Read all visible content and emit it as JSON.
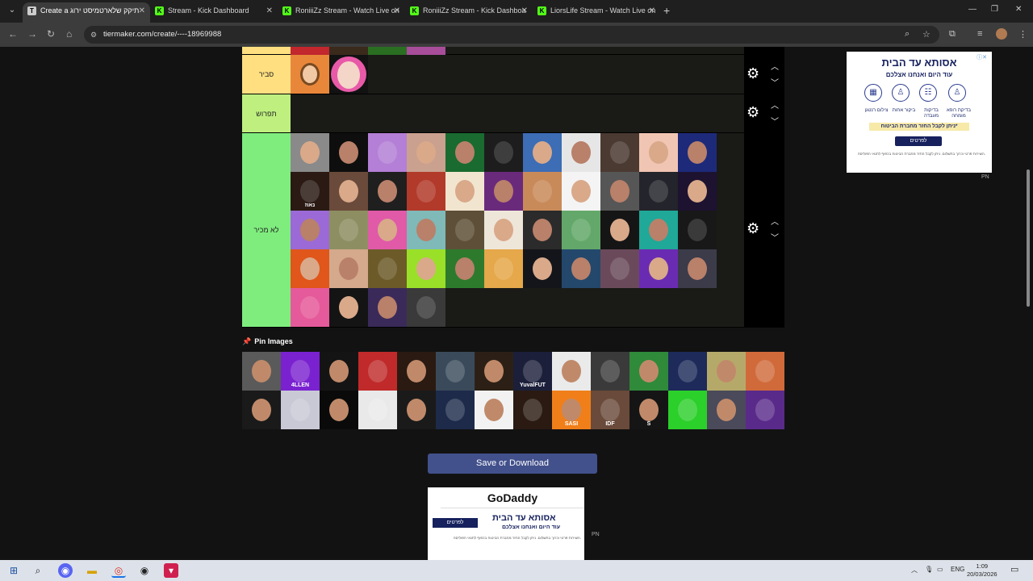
{
  "browser": {
    "tabs": [
      {
        "title": "Create a תיקק שלארטמיסט ירוג",
        "favicon": "tiermaker-icon",
        "active": true
      },
      {
        "title": "Stream - Kick Dashboard",
        "favicon": "kick-icon",
        "active": false
      },
      {
        "title": "RoniiiZz Stream - Watch Live on",
        "favicon": "kick-icon",
        "active": false
      },
      {
        "title": "RoniiiZz Stream - Kick Dashboa",
        "favicon": "kick-icon",
        "active": false
      },
      {
        "title": "LiorsLife Stream - Watch Live on",
        "favicon": "kick-icon",
        "active": false
      }
    ],
    "url": "tiermaker.com/create/----18969988"
  },
  "tiers": [
    {
      "label": "סביר",
      "color": "#ffdf80"
    },
    {
      "label": "תפרוש",
      "color": "#bff07f"
    },
    {
      "label": "לא מכיר",
      "color": "#7fed7e"
    }
  ],
  "pin": {
    "title": "Pin Images"
  },
  "pin_thumbs": [
    "",
    "4LLEN",
    "",
    "",
    "",
    "",
    "",
    "YuvalFUT",
    "",
    "",
    "",
    "",
    "",
    "",
    "",
    "",
    "",
    "",
    "",
    "",
    "",
    "",
    "SASI",
    "IDF",
    "S",
    "",
    ""
  ],
  "tier_thumbs_row3": [
    "",
    "",
    "",
    "",
    "",
    "",
    "",
    "",
    "",
    "",
    "",
    "נאוז",
    "",
    "",
    "",
    "",
    "",
    "",
    "",
    "",
    "",
    "",
    "",
    "",
    "",
    "",
    "",
    "",
    "",
    "",
    "",
    "",
    "",
    "",
    "",
    "",
    "",
    "",
    "",
    "",
    "",
    "",
    "",
    "",
    "",
    "",
    "",
    "",
    "",
    "",
    "",
    ""
  ],
  "save_button": "Save or Download",
  "ads": {
    "top": {
      "brand": "אסותא עד הבית",
      "subtitle": "עוד היום ואנחנו אצלכם",
      "services": [
        "בדיקת רופא מומחה",
        "בדיקות מעבדה",
        "ביקור אחות",
        "צילום רנטגן"
      ],
      "banner": "ניתן לקבל החזר מחברת הביטוח*",
      "cta": "לפרטים",
      "marker": "PN"
    },
    "bottom": {
      "godaddy": "GoDaddy",
      "brand": "אסותא עד הבית",
      "subtitle": "עוד היום ואנחנו אצלכם",
      "cta": "לפרטים",
      "marker": "PN"
    }
  },
  "taskbar": {
    "lang": "ENG",
    "time": "1:09",
    "date": "20/03/2026"
  }
}
